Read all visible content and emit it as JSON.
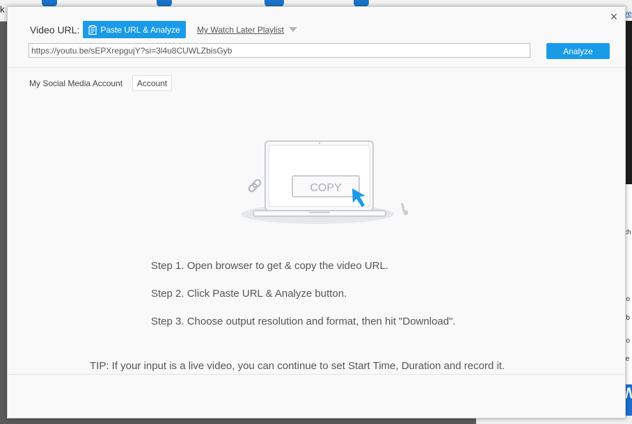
{
  "background": {
    "left_fragment": "k",
    "right_link_fragment": "ve",
    "right_text_fragments": [
      "ch",
      "ro",
      "rb",
      "ro",
      "te"
    ],
    "right_button_fragment": "W"
  },
  "dialog": {
    "close_glyph": "×",
    "video_url_label": "Video URL:",
    "paste_button_label": "Paste URL & Analyze",
    "playlist_link_label": "My Watch Later Playlist",
    "url_input_value": "https://youtu.be/sEPXrepgujY?si=3l4u8CUWLZbisGyb",
    "analyze_button_label": "Analyze",
    "social_label": "My Social Media Account",
    "account_button_label": "Account",
    "illustration": {
      "copy_label": "COPY"
    },
    "steps": [
      "Step 1. Open browser to get & copy the video URL.",
      "Step 2. Click Paste URL & Analyze button.",
      "Step 3. Choose output resolution and format, then hit \"Download\"."
    ],
    "tip": "TIP: If your input is a live video, you can continue to set Start Time, Duration and record it."
  },
  "colors": {
    "accent": "#1a9be8",
    "cursor_blue": "#1a9be8",
    "illustration_gray": "#c9ccd3"
  }
}
